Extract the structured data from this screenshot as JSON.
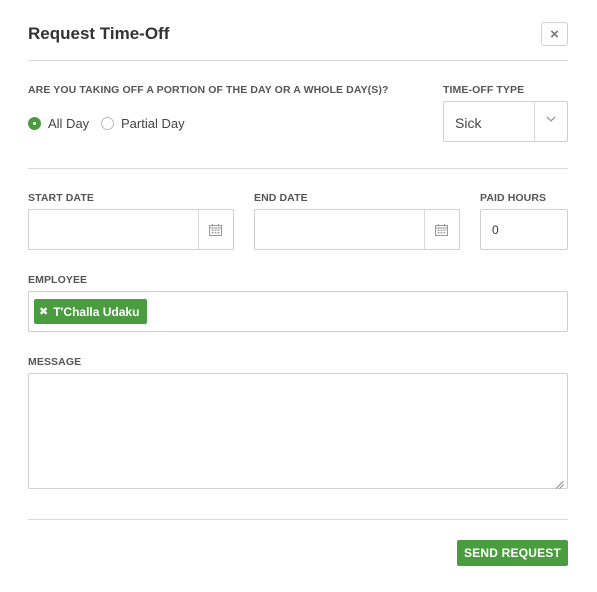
{
  "dialog": {
    "title": "Request Time-Off",
    "close_symbol": "×"
  },
  "portion": {
    "question": "ARE YOU TAKING OFF A PORTION OF THE DAY OR A WHOLE DAY(S)?",
    "options": [
      {
        "label": "All Day",
        "checked": true
      },
      {
        "label": "Partial Day",
        "checked": false
      }
    ]
  },
  "timeoff_type": {
    "label": "TIME-OFF TYPE",
    "selected": "Sick"
  },
  "start_date": {
    "label": "START DATE",
    "value": ""
  },
  "end_date": {
    "label": "END DATE",
    "value": ""
  },
  "paid_hours": {
    "label": "PAID HOURS",
    "value": "0"
  },
  "employee": {
    "label": "EMPLOYEE",
    "tags": [
      "T'Challa Udaku"
    ]
  },
  "message": {
    "label": "MESSAGE",
    "value": ""
  },
  "actions": {
    "send_label": "SEND REQUEST"
  },
  "colors": {
    "accent": "#4a9d3f",
    "border": "#cfcfcf",
    "text": "#333333"
  },
  "icons": {
    "close": "close-icon",
    "calendar": "calendar-icon",
    "chevron": "chevron-down-icon",
    "tag_remove": "remove-x-icon",
    "resize": "resize-grip-icon"
  }
}
